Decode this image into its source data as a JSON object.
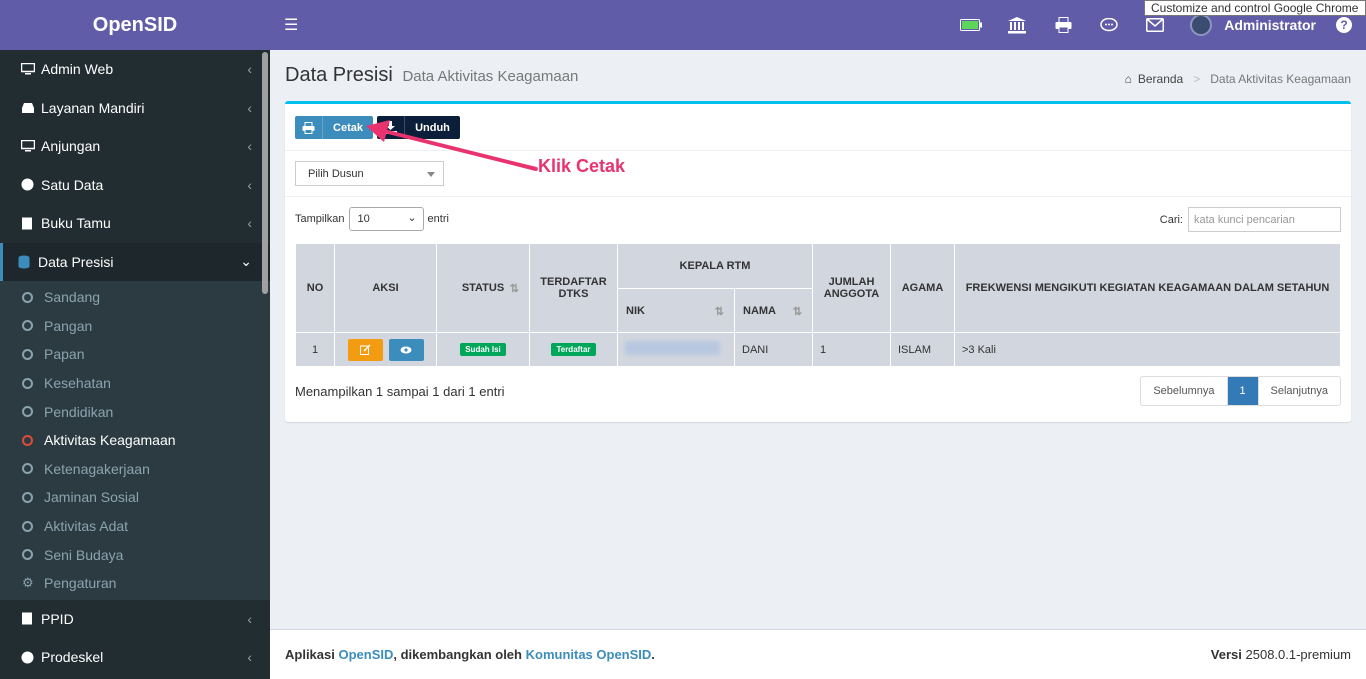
{
  "app": {
    "logo": "OpenSID"
  },
  "tooltip": "Customize and control Google Chrome",
  "sidebar": {
    "items_top": [
      {
        "label": "Admin Web",
        "icon": "monitor-icon"
      },
      {
        "label": "Layanan Mandiri",
        "icon": "inbox-icon"
      },
      {
        "label": "Anjungan",
        "icon": "monitor-icon"
      },
      {
        "label": "Satu Data",
        "icon": "globe-icon"
      },
      {
        "label": "Buku Tamu",
        "icon": "book-icon"
      }
    ],
    "active_item": {
      "label": "Data Presisi",
      "icon": "database-icon"
    },
    "submenu": [
      {
        "label": "Sandang"
      },
      {
        "label": "Pangan"
      },
      {
        "label": "Papan"
      },
      {
        "label": "Kesehatan"
      },
      {
        "label": "Pendidikan"
      },
      {
        "label": "Aktivitas Keagamaan",
        "active": true
      },
      {
        "label": "Ketenagakerjaan"
      },
      {
        "label": "Jaminan Sosial"
      },
      {
        "label": "Aktivitas Adat"
      },
      {
        "label": "Seni Budaya"
      },
      {
        "label": "Pengaturan",
        "icon": "gear-icon"
      }
    ],
    "items_bottom": [
      {
        "label": "PPID",
        "icon": "book-icon"
      },
      {
        "label": "Prodeskel",
        "icon": "globe-icon"
      }
    ]
  },
  "topbar": {
    "user": "Administrator",
    "help": "?"
  },
  "header": {
    "title": "Data Presisi",
    "subtitle": "Data Aktivitas Keagamaan",
    "breadcrumb_home": "Beranda",
    "breadcrumb_sep": ">",
    "breadcrumb_current": "Data Aktivitas Keagamaan"
  },
  "toolbar": {
    "cetak": "Cetak",
    "unduh": "Unduh"
  },
  "filter": {
    "dusun": "Pilih Dusun"
  },
  "table_ctrl": {
    "show_label": "Tampilkan",
    "show_value": "10",
    "entries_label": "entri",
    "search_label": "Cari:",
    "search_placeholder": "kata kunci pencarian"
  },
  "table": {
    "headers": {
      "no": "NO",
      "aksi": "AKSI",
      "status": "STATUS",
      "terdaftar": "TERDAFTAR DTKS",
      "kepala": "KEPALA RTM",
      "nik": "NIK",
      "nama": "NAMA",
      "jumlah": "JUMLAH ANGGOTA",
      "agama": "AGAMA",
      "frekwensi": "FREKWENSI MENGIKUTI KEGIATAN KEAGAMAAN DALAM SETAHUN"
    },
    "rows": [
      {
        "no": "1",
        "status": "Sudah Isi",
        "terdaftar": "Terdaftar",
        "nama": "DANI",
        "jumlah": "1",
        "agama": "ISLAM",
        "frekwensi": ">3 Kali"
      }
    ]
  },
  "info": "Menampilkan 1 sampai 1 dari 1 entri",
  "pagination": {
    "prev": "Sebelumnya",
    "current": "1",
    "next": "Selanjutnya"
  },
  "annotation": "Klik Cetak",
  "footer": {
    "left_prefix": "Aplikasi",
    "app_link": "OpenSID",
    "middle": ", dikembangkan oleh",
    "community_link": "Komunitas OpenSID",
    "end": ".",
    "version_label": "Versi",
    "version": "2508.0.1-premium"
  },
  "colors": {
    "header": "#605ca8",
    "sidebar": "#222d32",
    "accent": "#00c0ef",
    "annotation": "#e8336f"
  }
}
